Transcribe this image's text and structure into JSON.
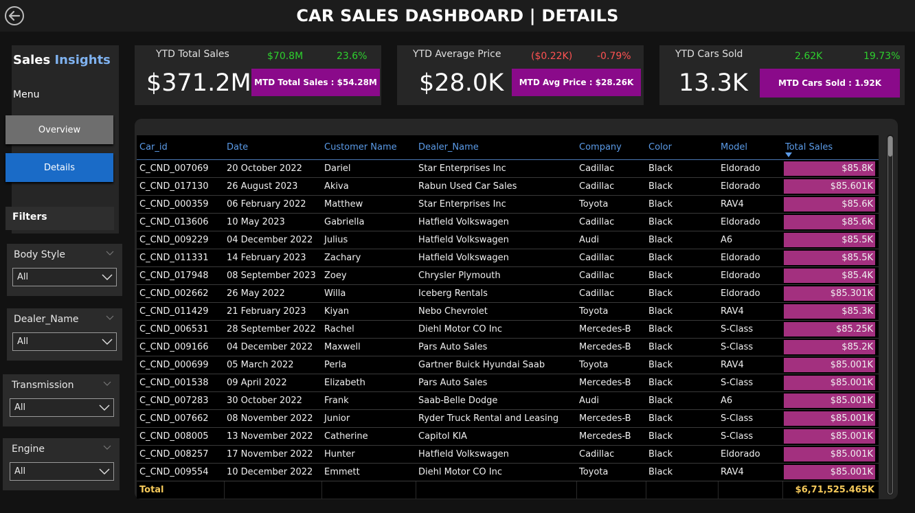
{
  "header": {
    "title": "CAR SALES DASHBOARD | DETAILS"
  },
  "sidebar": {
    "brand_part1": "Sales",
    "brand_part2": "Insights",
    "menu_label": "Menu",
    "nav": [
      {
        "label": "Overview"
      },
      {
        "label": "Details"
      }
    ],
    "filters_label": "Filters",
    "slicers": [
      {
        "title": "Body Style",
        "value": "All"
      },
      {
        "title": "Dealer_Name",
        "value": "All"
      },
      {
        "title": "Transmission",
        "value": "All"
      },
      {
        "title": "Engine",
        "value": "All"
      }
    ]
  },
  "kpis": [
    {
      "label": "YTD Total Sales",
      "value": "$371.2M",
      "delta": "$70.8M",
      "pct": "23.6%",
      "mtd": "MTD Total Sales : $54.28M"
    },
    {
      "label": "YTD Average Price",
      "value": "$28.0K",
      "delta": "($0.22K)",
      "pct": "-0.79%",
      "mtd": "MTD Avg Price : $28.26K"
    },
    {
      "label": "YTD Cars Sold",
      "value": "13.3K",
      "delta": "2.62K",
      "pct": "19.73%",
      "mtd": "MTD Cars Sold : 1.92K"
    }
  ],
  "colors": {
    "positive": "#2ed12e",
    "negative": "#ff5252",
    "accent": "#8a0a8a",
    "bar": "#a3307f",
    "header_text": "#5b9be8",
    "total_text": "#f5c95a"
  },
  "table": {
    "columns": [
      "Car_id",
      "Date",
      "Customer Name",
      "Dealer_Name",
      "Company",
      "Color",
      "Model",
      "Total Sales"
    ],
    "rows": [
      [
        "C_CND_007069",
        "20 October 2022",
        "Dariel",
        "Star Enterprises Inc",
        "Cadillac",
        "Black",
        "Eldorado",
        "$85.8K"
      ],
      [
        "C_CND_017130",
        "26 August 2023",
        "Akiva",
        "Rabun Used Car Sales",
        "Cadillac",
        "Black",
        "Eldorado",
        "$85.601K"
      ],
      [
        "C_CND_000359",
        "06 February 2022",
        "Matthew",
        "Star Enterprises Inc",
        "Toyota",
        "Black",
        "RAV4",
        "$85.6K"
      ],
      [
        "C_CND_013606",
        "10 May 2023",
        "Gabriella",
        "Hatfield Volkswagen",
        "Cadillac",
        "Black",
        "Eldorado",
        "$85.6K"
      ],
      [
        "C_CND_009229",
        "04 December 2022",
        "Julius",
        "Hatfield Volkswagen",
        "Audi",
        "Black",
        "A6",
        "$85.5K"
      ],
      [
        "C_CND_011331",
        "14 February 2023",
        "Zachary",
        "Hatfield Volkswagen",
        "Cadillac",
        "Black",
        "Eldorado",
        "$85.5K"
      ],
      [
        "C_CND_017948",
        "08 September 2023",
        "Zoey",
        "Chrysler Plymouth",
        "Cadillac",
        "Black",
        "Eldorado",
        "$85.4K"
      ],
      [
        "C_CND_002662",
        "26 May 2022",
        "Willa",
        "Iceberg Rentals",
        "Cadillac",
        "Black",
        "Eldorado",
        "$85.301K"
      ],
      [
        "C_CND_011429",
        "21 February 2023",
        "Kiyan",
        "Nebo Chevrolet",
        "Toyota",
        "Black",
        "RAV4",
        "$85.3K"
      ],
      [
        "C_CND_006531",
        "28 September 2022",
        "Rachel",
        "Diehl Motor CO Inc",
        "Mercedes-B",
        "Black",
        "S-Class",
        "$85.25K"
      ],
      [
        "C_CND_009166",
        "04 December 2022",
        "Maxwell",
        "Pars Auto Sales",
        "Mercedes-B",
        "Black",
        "S-Class",
        "$85.2K"
      ],
      [
        "C_CND_000699",
        "05 March 2022",
        "Perla",
        "Gartner Buick Hyundai Saab",
        "Toyota",
        "Black",
        "RAV4",
        "$85.001K"
      ],
      [
        "C_CND_001538",
        "09 April 2022",
        "Elizabeth",
        "Pars Auto Sales",
        "Mercedes-B",
        "Black",
        "S-Class",
        "$85.001K"
      ],
      [
        "C_CND_007283",
        "30 October 2022",
        "Frank",
        "Saab-Belle Dodge",
        "Audi",
        "Black",
        "A6",
        "$85.001K"
      ],
      [
        "C_CND_007662",
        "08 November 2022",
        "Junior",
        "Ryder Truck Rental and Leasing",
        "Mercedes-B",
        "Black",
        "S-Class",
        "$85.001K"
      ],
      [
        "C_CND_008005",
        "13 November 2022",
        "Catherine",
        "Capitol KIA",
        "Mercedes-B",
        "Black",
        "S-Class",
        "$85.001K"
      ],
      [
        "C_CND_008257",
        "17 November 2022",
        "Hunter",
        "Hatfield Volkswagen",
        "Cadillac",
        "Black",
        "Eldorado",
        "$85.001K"
      ],
      [
        "C_CND_009554",
        "10 December 2022",
        "Emmett",
        "Diehl Motor CO Inc",
        "Toyota",
        "Black",
        "RAV4",
        "$85.001K"
      ]
    ],
    "total_label": "Total",
    "total_value": "$6,71,525.465K"
  },
  "icons": {
    "back": "back-arrow-icon",
    "sort": "sort-desc-icon",
    "chevron": "chevron-down-icon"
  }
}
